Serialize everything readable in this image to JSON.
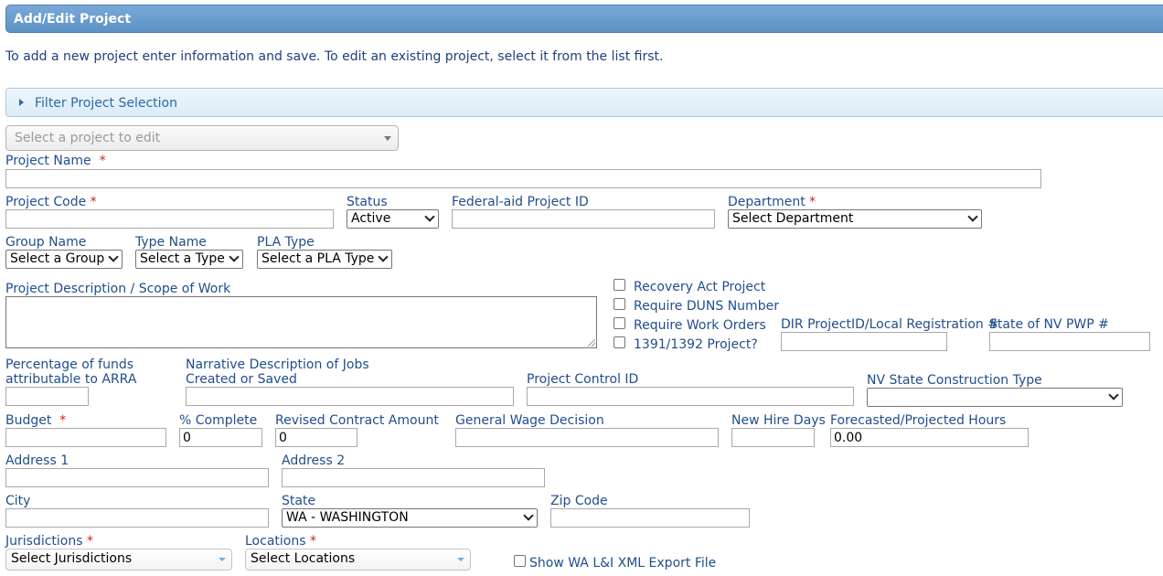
{
  "header": {
    "title": "Add/Edit Project"
  },
  "intro": "To add a new project enter information and save. To edit an existing project, select it from the list first.",
  "filter": {
    "label": "Filter Project Selection"
  },
  "project_select": {
    "placeholder": "Select a project to edit"
  },
  "required_mark": "*",
  "fields": {
    "project_name": {
      "label": "Project Name",
      "value": ""
    },
    "project_code": {
      "label": "Project Code",
      "value": ""
    },
    "status": {
      "label": "Status",
      "value": "Active"
    },
    "federal_aid_id": {
      "label": "Federal-aid Project ID",
      "value": ""
    },
    "department": {
      "label": "Department",
      "value": "Select Department"
    },
    "group_name": {
      "label": "Group Name",
      "value": "Select a Group"
    },
    "type_name": {
      "label": "Type Name",
      "value": "Select a Type"
    },
    "pla_type": {
      "label": "PLA Type",
      "value": "Select a PLA Type"
    },
    "description": {
      "label": "Project Description / Scope of Work",
      "value": ""
    },
    "dir_project_id": {
      "label": "DIR ProjectID/Local Registration #",
      "value": ""
    },
    "nv_pwp": {
      "label": "State of NV PWP #",
      "value": ""
    },
    "arra_pct": {
      "label_line1": "Percentage of funds",
      "label_line2": "attributable to ARRA",
      "value": ""
    },
    "narrative": {
      "label_line1": "Narrative Description of Jobs",
      "label_line2": "Created or Saved",
      "value": ""
    },
    "control_id": {
      "label": "Project Control ID",
      "value": ""
    },
    "nv_construction_type": {
      "label": "NV State Construction Type",
      "value": ""
    },
    "budget": {
      "label": "Budget",
      "value": ""
    },
    "pct_complete": {
      "label": "% Complete",
      "value": "0"
    },
    "revised_amount": {
      "label": "Revised Contract Amount",
      "value": "0"
    },
    "wage_decision": {
      "label": "General Wage Decision",
      "value": ""
    },
    "new_hire_days": {
      "label": "New Hire Days",
      "value": ""
    },
    "projected_hours": {
      "label": "Forecasted/Projected Hours",
      "value": "0.00"
    },
    "address1": {
      "label": "Address 1",
      "value": ""
    },
    "address2": {
      "label": "Address 2",
      "value": ""
    },
    "city": {
      "label": "City",
      "value": ""
    },
    "state": {
      "label": "State",
      "value": "WA - WASHINGTON"
    },
    "zip": {
      "label": "Zip Code",
      "value": ""
    },
    "jurisdictions": {
      "label": "Jurisdictions",
      "value": "Select Jurisdictions"
    },
    "locations": {
      "label": "Locations",
      "value": "Select Locations"
    }
  },
  "checkboxes": {
    "recovery_act": {
      "label": "Recovery Act Project",
      "checked": false
    },
    "require_duns": {
      "label": "Require DUNS Number",
      "checked": false
    },
    "require_work_orders": {
      "label": "Require Work Orders",
      "checked": false
    },
    "project_1391": {
      "label": "1391/1392 Project?",
      "checked": false
    },
    "wa_xml_export": {
      "label": "Show WA L&I XML Export File",
      "checked": false
    }
  }
}
